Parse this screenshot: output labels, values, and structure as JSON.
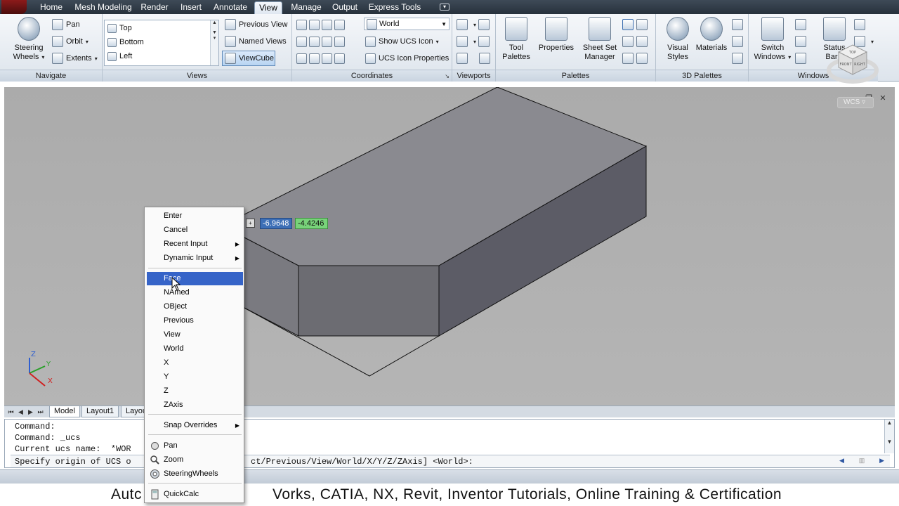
{
  "tabs": [
    "Home",
    "Mesh Modeling",
    "Render",
    "Insert",
    "Annotate",
    "View",
    "Manage",
    "Output",
    "Express Tools"
  ],
  "active_tab": "View",
  "ribbon": {
    "navigate": {
      "title": "Navigate",
      "steering_wheels": [
        "Steering",
        "Wheels"
      ],
      "pan": "Pan",
      "orbit": "Orbit",
      "extents": "Extents"
    },
    "views": {
      "title": "Views",
      "list": [
        "Top",
        "Bottom",
        "Left"
      ],
      "previous_view": "Previous View",
      "named_views": "Named Views",
      "viewcube": "ViewCube"
    },
    "coordinates": {
      "title": "Coordinates",
      "ucs_combo": "World",
      "show_ucs_icon": "Show UCS Icon",
      "ucs_icon_properties": "UCS Icon Properties"
    },
    "viewports": {
      "title": "Viewports"
    },
    "palettes": {
      "title": "Palettes",
      "tool_palettes": [
        "Tool",
        "Palettes"
      ],
      "properties": "Properties",
      "sheet_set_manager": [
        "Sheet Set",
        "Manager"
      ]
    },
    "palettes3d": {
      "title": "3D Palettes",
      "visual_styles": [
        "Visual",
        "Styles"
      ],
      "materials": "Materials"
    },
    "windows": {
      "title": "Windows",
      "switch_windows": [
        "Switch",
        "Windows"
      ],
      "status_bar": [
        "Status",
        "Bar"
      ]
    }
  },
  "viewport": {
    "wcs_label": "WCS",
    "viewcube_faces": [
      "TOP",
      "FRONT",
      "RIGHT"
    ],
    "coord_x": "-6.9648",
    "coord_y": "-4.4246",
    "ucs_axes": [
      "Z",
      "Y",
      "X"
    ]
  },
  "layout_tabs": [
    "Model",
    "Layout1",
    "Layou"
  ],
  "command_lines": [
    "Command:",
    "Command: _ucs",
    "Current ucs name:  *WOR",
    "Specify origin of UCS o"
  ],
  "command_prompt_tail": "ct/Previous/View/World/X/Y/Z/ZAxis] <World>:",
  "context_menu": {
    "items": [
      {
        "label": "Enter",
        "submenu": false
      },
      {
        "label": "Cancel",
        "submenu": false
      },
      {
        "label": "Recent Input",
        "submenu": true
      },
      {
        "label": "Dynamic Input",
        "submenu": true
      },
      {
        "label": "Face",
        "submenu": false,
        "highlighted": true
      },
      {
        "label": "NAmed",
        "submenu": false
      },
      {
        "label": "OBject",
        "submenu": false
      },
      {
        "label": "Previous",
        "submenu": false
      },
      {
        "label": "View",
        "submenu": false
      },
      {
        "label": "World",
        "submenu": false
      },
      {
        "label": "X",
        "submenu": false
      },
      {
        "label": "Y",
        "submenu": false
      },
      {
        "label": "Z",
        "submenu": false
      },
      {
        "label": "ZAxis",
        "submenu": false
      },
      {
        "label": "Snap Overrides",
        "submenu": true
      },
      {
        "label": "Pan",
        "icon": "pan-hand-icon"
      },
      {
        "label": "Zoom",
        "icon": "zoom-magnifier-icon"
      },
      {
        "label": "SteeringWheels",
        "icon": "steering-wheel-icon"
      },
      {
        "label": "QuickCalc",
        "icon": "calculator-icon"
      }
    ]
  },
  "banner": {
    "text_left": "Autc",
    "text_right": "Vorks, CATIA, NX, Revit, Inventor Tutorials, Online Training & Certification"
  },
  "colors": {
    "menu_highlight": "#3664c8",
    "coord_x_bg": "#3d6fb6",
    "coord_y_bg": "#78d37a",
    "box_top": "#8a8a90",
    "box_side": "#5c5c66",
    "box_front": "#6c6c72"
  }
}
